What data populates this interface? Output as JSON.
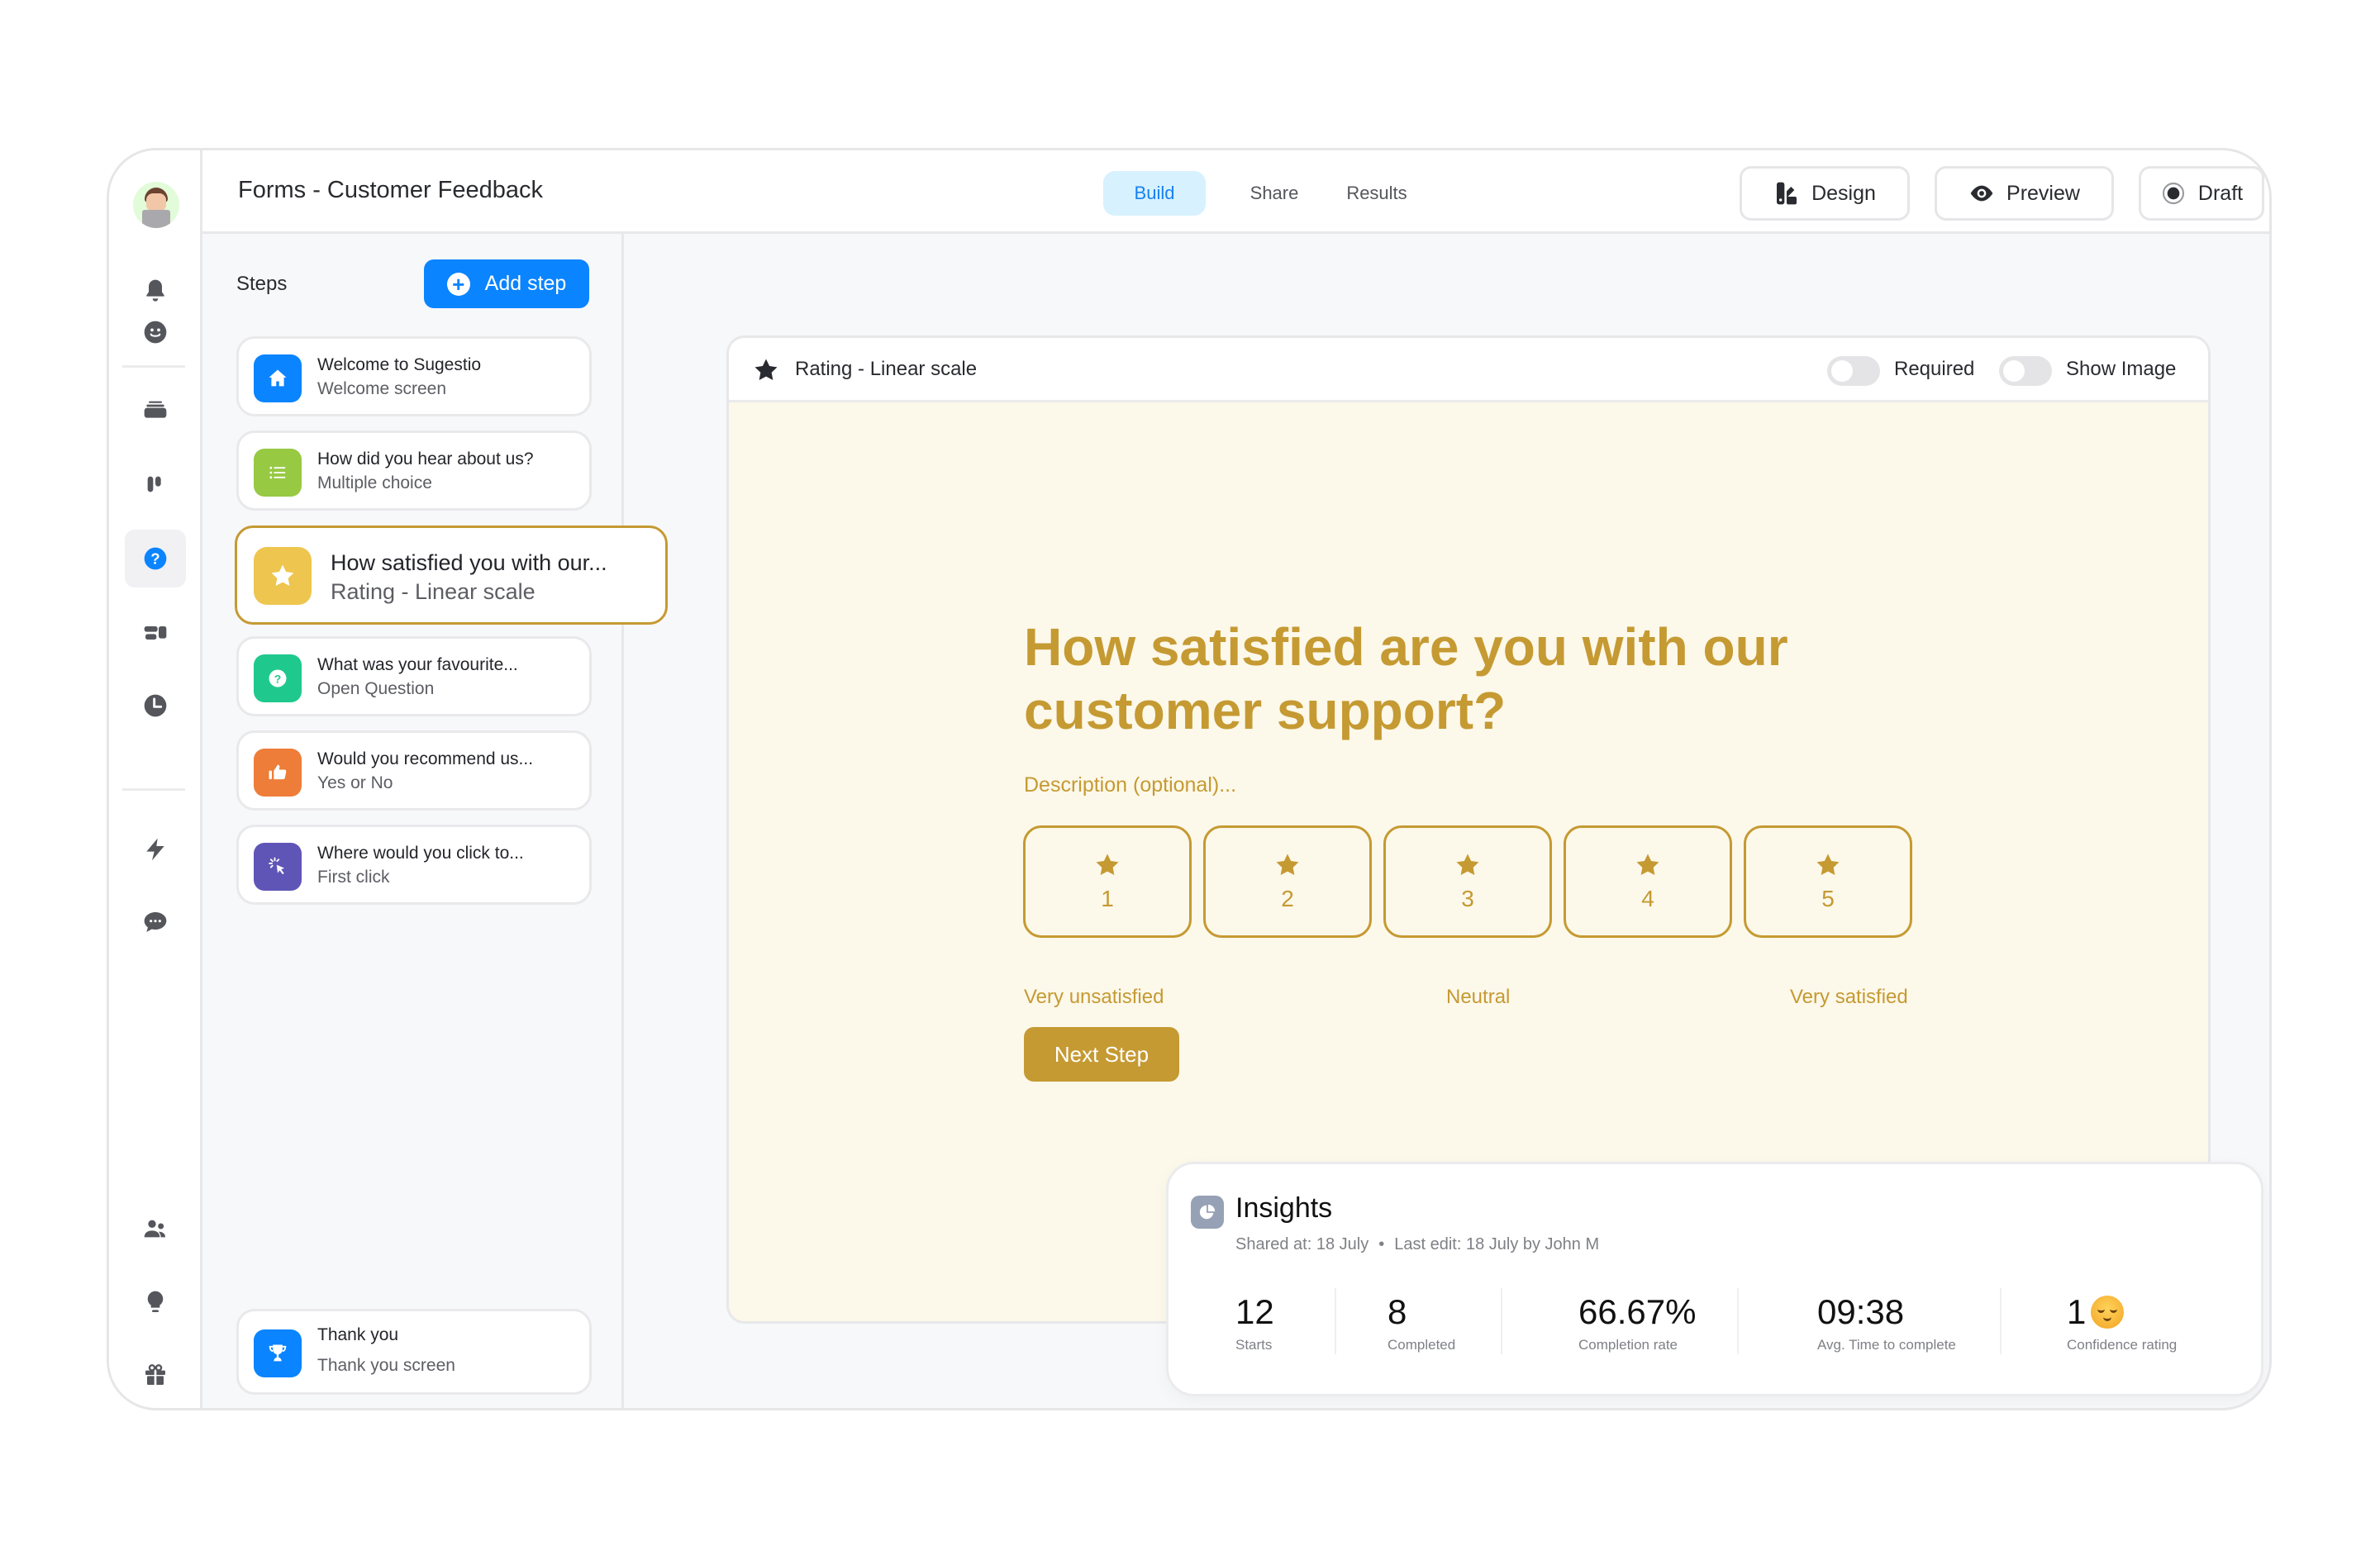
{
  "header": {
    "title": "Forms - Customer Feedback",
    "tabs": [
      {
        "label": "Build",
        "active": true
      },
      {
        "label": "Share",
        "active": false
      },
      {
        "label": "Results",
        "active": false
      }
    ],
    "buttons": {
      "design": "Design",
      "preview": "Preview",
      "draft": "Draft"
    }
  },
  "sidebar": {
    "avatar": "user-avatar",
    "items": [
      {
        "icon": "bell-icon"
      },
      {
        "icon": "smiley-icon"
      },
      {
        "icon": "stack-icon"
      },
      {
        "icon": "kanban-icon"
      },
      {
        "icon": "question-icon",
        "active": true
      },
      {
        "icon": "dashboard-icon"
      },
      {
        "icon": "clock-icon"
      },
      {
        "icon": "lightning-icon"
      },
      {
        "icon": "chat-icon"
      },
      {
        "icon": "users-icon"
      },
      {
        "icon": "lightbulb-icon"
      },
      {
        "icon": "gift-icon"
      }
    ]
  },
  "steps": {
    "label": "Steps",
    "add_label": "Add step",
    "items": [
      {
        "title": "Welcome to Sugestio",
        "type": "Welcome screen",
        "icon": "home-icon",
        "color": "#0a84ff"
      },
      {
        "title": "How did you hear about us?",
        "type": "Multiple choice",
        "icon": "list-icon",
        "color": "#97c943"
      },
      {
        "title": "How satisfied you with our...",
        "type": "Rating - Linear scale",
        "icon": "star-icon",
        "color": "#eec54e",
        "active": true
      },
      {
        "title": "What was your favourite...",
        "type": "Open Question",
        "icon": "question-icon",
        "color": "#1fc98d"
      },
      {
        "title": "Would you recommend us...",
        "type": "Yes or No",
        "icon": "thumbs-up-icon",
        "color": "#ed7d38"
      },
      {
        "title": "Where would you click to...",
        "type": "First click",
        "icon": "cursor-click-icon",
        "color": "#5f55b7"
      }
    ],
    "thank_you": {
      "title": "Thank you",
      "type": "Thank you screen",
      "icon": "trophy-icon",
      "color": "#0a84ff"
    }
  },
  "form": {
    "type_label": "Rating - Linear scale",
    "toggles": [
      {
        "label": "Required",
        "on": false
      },
      {
        "label": "Show Image",
        "on": false
      }
    ],
    "question": "How satisfied are you with our customer support?",
    "description_placeholder": "Description (optional)...",
    "scale": [
      "1",
      "2",
      "3",
      "4",
      "5"
    ],
    "scale_labels": {
      "low": "Very unsatisfied",
      "mid": "Neutral",
      "high": "Very satisfied"
    },
    "next_label": "Next Step",
    "accent": "#c59a32",
    "background": "#fcf8ea"
  },
  "insights": {
    "title": "Insights",
    "shared": "Shared at: 18 July",
    "separator": "•",
    "last_edit": "Last edit: 18 July by John M",
    "stats": [
      {
        "value": "12",
        "label": "Starts"
      },
      {
        "value": "8",
        "label": "Completed"
      },
      {
        "value": "66.67%",
        "label": "Completion rate"
      },
      {
        "value": "09:38",
        "label": "Avg. Time to complete"
      },
      {
        "value": "1",
        "label": "Confidence rating",
        "emoji": "relieved-face"
      }
    ]
  }
}
